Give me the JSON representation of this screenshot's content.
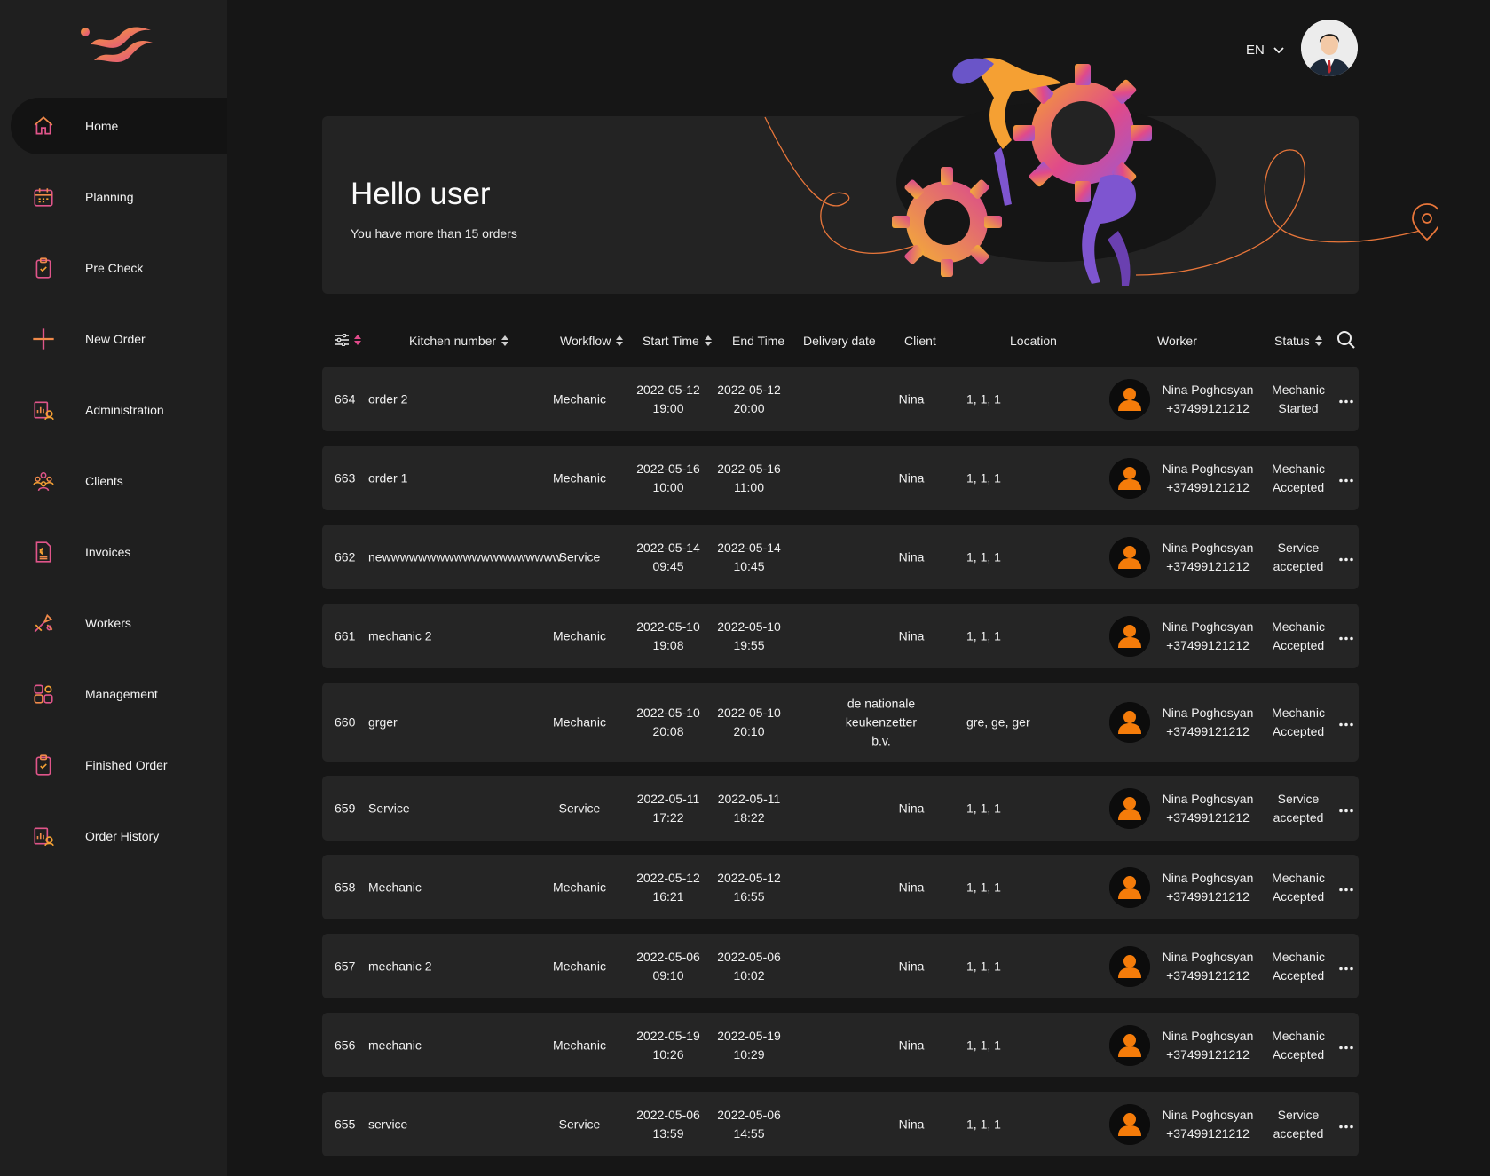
{
  "language": "EN",
  "nav": [
    {
      "label": "Home",
      "icon": "home-icon",
      "active": true
    },
    {
      "label": "Planning",
      "icon": "calendar-icon"
    },
    {
      "label": "Pre Check",
      "icon": "clipboard-check-icon"
    },
    {
      "label": "New Order",
      "icon": "plus-icon"
    },
    {
      "label": "Administration",
      "icon": "administration-icon"
    },
    {
      "label": "Clients",
      "icon": "clients-icon"
    },
    {
      "label": "Invoices",
      "icon": "invoice-icon"
    },
    {
      "label": "Workers",
      "icon": "workers-icon"
    },
    {
      "label": "Management",
      "icon": "management-icon"
    },
    {
      "label": "Finished Order",
      "icon": "finished-order-icon"
    },
    {
      "label": "Order History",
      "icon": "order-history-icon"
    }
  ],
  "hero": {
    "title": "Hello user",
    "subtitle": "You have more than 15 orders"
  },
  "table": {
    "headers": {
      "kitchen_number": "Kitchen number",
      "workflow": "Workflow",
      "start_time": "Start Time",
      "end_time": "End Time",
      "delivery_date": "Delivery date",
      "client": "Client",
      "location": "Location",
      "worker": "Worker",
      "status": "Status"
    },
    "rows": [
      {
        "id": "664",
        "name": "order 2",
        "workflow": "Mechanic",
        "start_date": "2022-05-12",
        "start_time": "19:00",
        "end_date": "2022-05-12",
        "end_time": "20:00",
        "client": "Nina",
        "location": "1, 1, 1",
        "worker_name": "Nina Poghosyan",
        "worker_phone": "+37499121212",
        "status_line1": "Mechanic",
        "status_line2": "Started"
      },
      {
        "id": "663",
        "name": "order 1",
        "workflow": "Mechanic",
        "start_date": "2022-05-16",
        "start_time": "10:00",
        "end_date": "2022-05-16",
        "end_time": "11:00",
        "client": "Nina",
        "location": "1, 1, 1",
        "worker_name": "Nina Poghosyan",
        "worker_phone": "+37499121212",
        "status_line1": "Mechanic",
        "status_line2": "Accepted"
      },
      {
        "id": "662",
        "name": "newwwwwwwwwwwwwwwwwwww",
        "workflow": "Service",
        "start_date": "2022-05-14",
        "start_time": "09:45",
        "end_date": "2022-05-14",
        "end_time": "10:45",
        "client": "Nina",
        "location": "1, 1, 1",
        "worker_name": "Nina Poghosyan",
        "worker_phone": "+37499121212",
        "status_line1": "Service",
        "status_line2": "accepted"
      },
      {
        "id": "661",
        "name": "mechanic 2",
        "workflow": "Mechanic",
        "start_date": "2022-05-10",
        "start_time": "19:08",
        "end_date": "2022-05-10",
        "end_time": "19:55",
        "client": "Nina",
        "location": "1, 1, 1",
        "worker_name": "Nina Poghosyan",
        "worker_phone": "+37499121212",
        "status_line1": "Mechanic",
        "status_line2": "Accepted"
      },
      {
        "id": "660",
        "name": "grger",
        "workflow": "Mechanic",
        "start_date": "2022-05-10",
        "start_time": "20:08",
        "end_date": "2022-05-10",
        "end_time": "20:10",
        "client": "de nationale keukenzetter b.v.",
        "location": "gre, ge, ger",
        "worker_name": "Nina Poghosyan",
        "worker_phone": "+37499121212",
        "status_line1": "Mechanic",
        "status_line2": "Accepted",
        "tall": true
      },
      {
        "id": "659",
        "name": "Service",
        "workflow": "Service",
        "start_date": "2022-05-11",
        "start_time": "17:22",
        "end_date": "2022-05-11",
        "end_time": "18:22",
        "client": "Nina",
        "location": "1, 1, 1",
        "worker_name": "Nina Poghosyan",
        "worker_phone": "+37499121212",
        "status_line1": "Service",
        "status_line2": "accepted"
      },
      {
        "id": "658",
        "name": "Mechanic",
        "workflow": "Mechanic",
        "start_date": "2022-05-12",
        "start_time": "16:21",
        "end_date": "2022-05-12",
        "end_time": "16:55",
        "client": "Nina",
        "location": "1, 1, 1",
        "worker_name": "Nina Poghosyan",
        "worker_phone": "+37499121212",
        "status_line1": "Mechanic",
        "status_line2": "Accepted"
      },
      {
        "id": "657",
        "name": "mechanic 2",
        "workflow": "Mechanic",
        "start_date": "2022-05-06",
        "start_time": "09:10",
        "end_date": "2022-05-06",
        "end_time": "10:02",
        "client": "Nina",
        "location": "1, 1, 1",
        "worker_name": "Nina Poghosyan",
        "worker_phone": "+37499121212",
        "status_line1": "Mechanic",
        "status_line2": "Accepted"
      },
      {
        "id": "656",
        "name": "mechanic",
        "workflow": "Mechanic",
        "start_date": "2022-05-19",
        "start_time": "10:26",
        "end_date": "2022-05-19",
        "end_time": "10:29",
        "client": "Nina",
        "location": "1, 1, 1",
        "worker_name": "Nina Poghosyan",
        "worker_phone": "+37499121212",
        "status_line1": "Mechanic",
        "status_line2": "Accepted"
      },
      {
        "id": "655",
        "name": "service",
        "workflow": "Service",
        "start_date": "2022-05-06",
        "start_time": "13:59",
        "end_date": "2022-05-06",
        "end_time": "14:55",
        "client": "Nina",
        "location": "1, 1, 1",
        "worker_name": "Nina Poghosyan",
        "worker_phone": "+37499121212",
        "status_line1": "Service",
        "status_line2": "accepted"
      }
    ]
  },
  "colors": {
    "accent_orange": "#f5a033",
    "accent_pink": "#e04a8a",
    "accent_purple": "#9b59d0",
    "background": "#161616",
    "sidebar": "#1f1f1f",
    "card": "#252525"
  }
}
